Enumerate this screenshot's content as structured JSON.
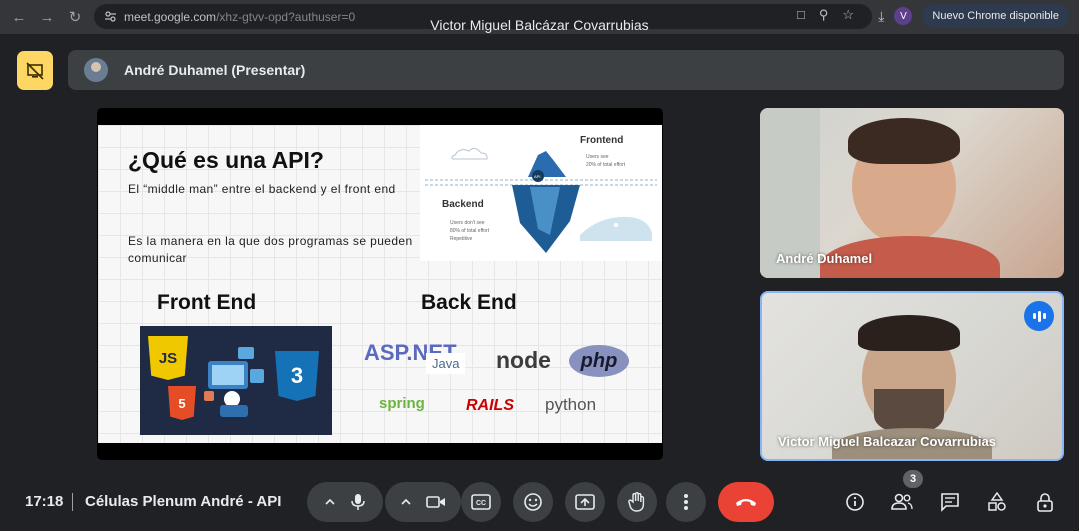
{
  "browser": {
    "url_domain": "meet.google.com",
    "url_path": "/xhz-gtvv-opd?authuser=0",
    "window_title": "Victor Miguel Balcázar Covarrubias",
    "profile_initial": "V",
    "update_label": "Nuevo Chrome disponible"
  },
  "presenter": {
    "label": "André Duhamel (Presentar)"
  },
  "slide": {
    "title": "¿Qué es una API?",
    "para1": "El “middle man” entre el backend y el front end",
    "para2": "Es la manera en la que dos programas se pueden comunicar",
    "iceberg_frontend": "Frontend",
    "iceberg_frontend_notes": [
      "Users see",
      "20% of total effort"
    ],
    "iceberg_backend": "Backend",
    "iceberg_backend_notes": [
      "Users don't see",
      "80% of total effort",
      "Repetitive"
    ],
    "iceberg_api": "API",
    "front_end_title": "Front End",
    "back_end_title": "Back End",
    "front_logos": [
      "JS",
      "5",
      "3"
    ],
    "back_logos": [
      "ASP.NET",
      "Java",
      "node",
      "php",
      "spring",
      "RAILS",
      "python"
    ]
  },
  "participants": [
    {
      "name": "André Duhamel"
    },
    {
      "name": "Victor Miguel Balcazar Covarrubias"
    }
  ],
  "meeting": {
    "time": "17:18",
    "name": "Células Plenum André - API",
    "people_count": "3"
  },
  "colors": {
    "accent": "#8ab4f8",
    "end_call": "#ea4335",
    "present_button": "#fdd663",
    "speaking": "#1a73e8"
  }
}
